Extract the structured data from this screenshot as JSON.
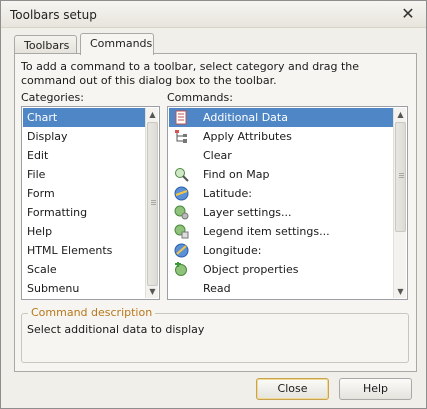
{
  "window": {
    "title": "Toolbars setup",
    "close_glyph": "✕"
  },
  "tabs": [
    {
      "label": "Toolbars",
      "active": false
    },
    {
      "label": "Commands",
      "active": true
    }
  ],
  "instructions": "To add a command to a toolbar, select category and drag the command out of this dialog box to the toolbar.",
  "categories": {
    "label": "Categories:",
    "items": [
      "Chart",
      "Display",
      "Edit",
      "File",
      "Form",
      "Formatting",
      "Help",
      "HTML Elements",
      "Scale",
      "Submenu"
    ],
    "selected": "Chart"
  },
  "commands": {
    "label": "Commands:",
    "items": [
      {
        "label": "Additional Data",
        "icon": "additional-data-icon"
      },
      {
        "label": "Apply Attributes",
        "icon": "apply-attributes-icon"
      },
      {
        "label": "Clear",
        "icon": ""
      },
      {
        "label": "Find on Map",
        "icon": "find-on-map-icon"
      },
      {
        "label": "Latitude:",
        "icon": "latitude-icon"
      },
      {
        "label": "Layer settings...",
        "icon": "layer-settings-icon"
      },
      {
        "label": "Legend item settings...",
        "icon": "legend-settings-icon"
      },
      {
        "label": "Longitude:",
        "icon": "longitude-icon"
      },
      {
        "label": "Object properties",
        "icon": "object-properties-icon"
      },
      {
        "label": "Read",
        "icon": ""
      }
    ],
    "selected": "Additional Data"
  },
  "description": {
    "legend": "Command description",
    "text": "Select additional data to display"
  },
  "buttons": {
    "close": "Close",
    "help": "Help"
  },
  "colors": {
    "selection": "#4f86c6",
    "legend_text": "#b8781c",
    "window_bg": "#f0efe9"
  }
}
